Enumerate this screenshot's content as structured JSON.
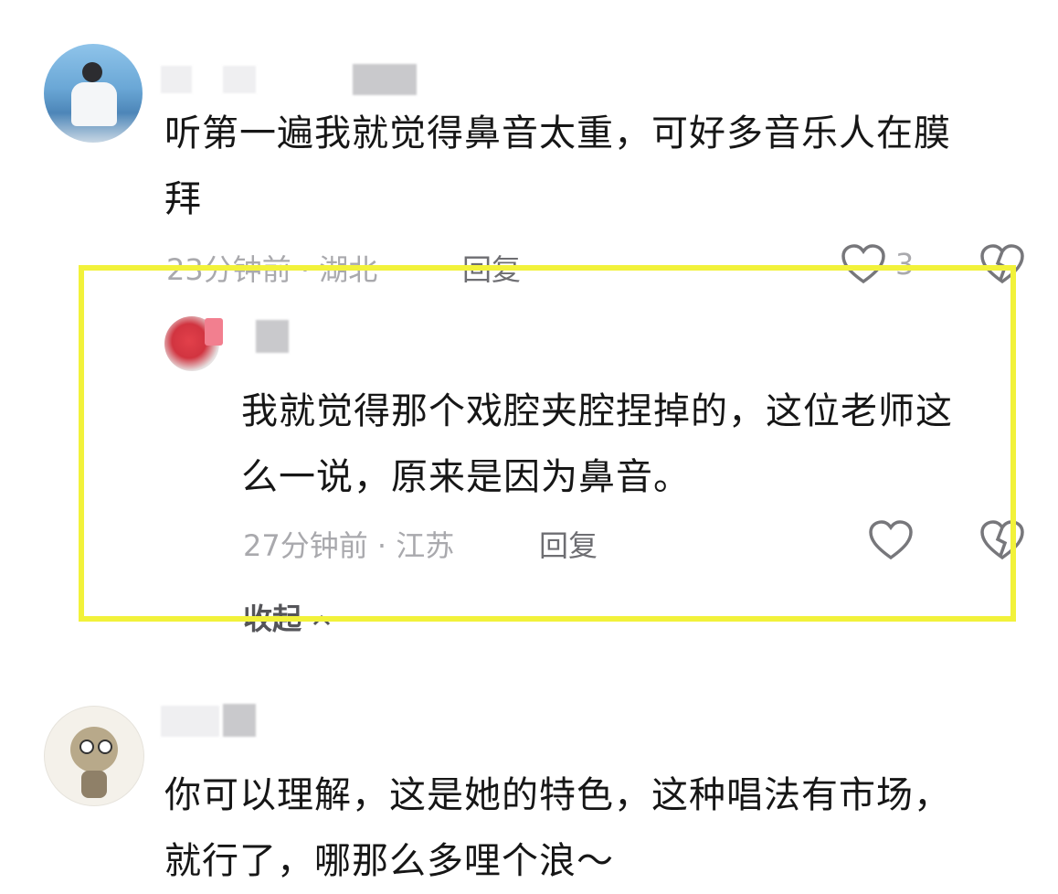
{
  "comments": [
    {
      "text_line1": "听第一遍我就觉得鼻音太重，可好多音乐人在膜",
      "text_line2": "拜",
      "time": "23分钟前",
      "location": "湖北",
      "reply_label": "回复",
      "like_count": "3",
      "reply": {
        "text_line1": "我就觉得那个戏腔夹腔捏掉的，这位老师这",
        "text_line2": "么一说，原来是因为鼻音。",
        "time": "27分钟前",
        "location": "江苏",
        "reply_label": "回复",
        "collapse_label": "收起"
      }
    },
    {
      "text_line1": "你可以理解，这是她的特色，这种唱法有市场，",
      "text_line2": "就行了，哪那么多哩个浪～"
    }
  ],
  "meta_separator": "·",
  "colors": {
    "highlight": "#f2f23a",
    "meta": "#a9a9ad",
    "text": "#161616"
  },
  "icons": [
    "heart-icon",
    "dislike-heart-icon",
    "chevron-up-icon"
  ]
}
